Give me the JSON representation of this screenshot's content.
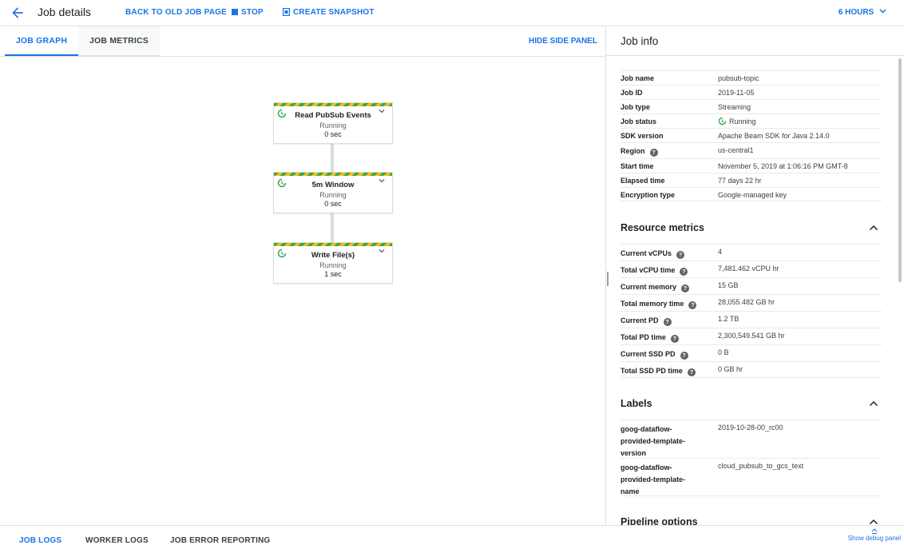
{
  "header": {
    "title": "Job details",
    "back_old_label": "BACK TO OLD JOB PAGE",
    "stop_label": "STOP",
    "snapshot_label": "CREATE SNAPSHOT",
    "hours_label": "6 HOURS"
  },
  "tabs": {
    "job_graph": "JOB GRAPH",
    "job_metrics": "JOB METRICS",
    "hide_panel": "HIDE SIDE PANEL"
  },
  "graph": {
    "nodes": [
      {
        "name": "Read PubSub Events",
        "status": "Running",
        "time": "0 sec"
      },
      {
        "name": "5m Window",
        "status": "Running",
        "time": "0 sec"
      },
      {
        "name": "Write File(s)",
        "status": "Running",
        "time": "1 sec"
      }
    ]
  },
  "job_info": {
    "title": "Job info",
    "rows": [
      {
        "key": "Job name",
        "value": "pubsub-topic"
      },
      {
        "key": "Job ID",
        "value": "2019-11-05"
      },
      {
        "key": "Job type",
        "value": "Streaming"
      },
      {
        "key": "Job status",
        "value": "Running"
      },
      {
        "key": "SDK version",
        "value": "Apache Beam SDK for Java 2.14.0"
      },
      {
        "key": "Region",
        "value": "us-central1"
      },
      {
        "key": "Start time",
        "value": "November 5, 2019 at 1:06:16 PM GMT-8"
      },
      {
        "key": "Elapsed time",
        "value": "77 days 22 hr"
      },
      {
        "key": "Encryption type",
        "value": "Google-managed key"
      }
    ]
  },
  "resource_metrics": {
    "title": "Resource metrics",
    "rows": [
      {
        "key": "Current vCPUs",
        "value": "4"
      },
      {
        "key": "Total vCPU time",
        "value": "7,481.462 vCPU hr"
      },
      {
        "key": "Current memory",
        "value": "15 GB"
      },
      {
        "key": "Total memory time",
        "value": "28,055.482 GB hr"
      },
      {
        "key": "Current PD",
        "value": "1.2 TB"
      },
      {
        "key": "Total PD time",
        "value": "2,300,549.541 GB hr"
      },
      {
        "key": "Current SSD PD",
        "value": "0 B"
      },
      {
        "key": "Total SSD PD time",
        "value": "0 GB hr"
      }
    ]
  },
  "labels": {
    "title": "Labels",
    "rows": [
      {
        "key_lines": [
          "goog-dataflow-",
          "provided-template-",
          "version"
        ],
        "value": "2019-10-28-00_rc00"
      },
      {
        "key_lines": [
          "goog-dataflow-",
          "provided-template-",
          "name"
        ],
        "value": "cloud_pubsub_to_gcs_text"
      }
    ]
  },
  "pipeline_options": {
    "title": "Pipeline options"
  },
  "help_glyph": "?",
  "bottom": {
    "job_logs": "JOB LOGS",
    "worker_logs": "WORKER LOGS",
    "error_reporting": "JOB ERROR REPORTING",
    "debug_panel": "Show debug panel"
  },
  "colors": {
    "accent": "#1a73e8",
    "running_green": "#34a853",
    "stripe_yellow": "#fbbc04"
  }
}
